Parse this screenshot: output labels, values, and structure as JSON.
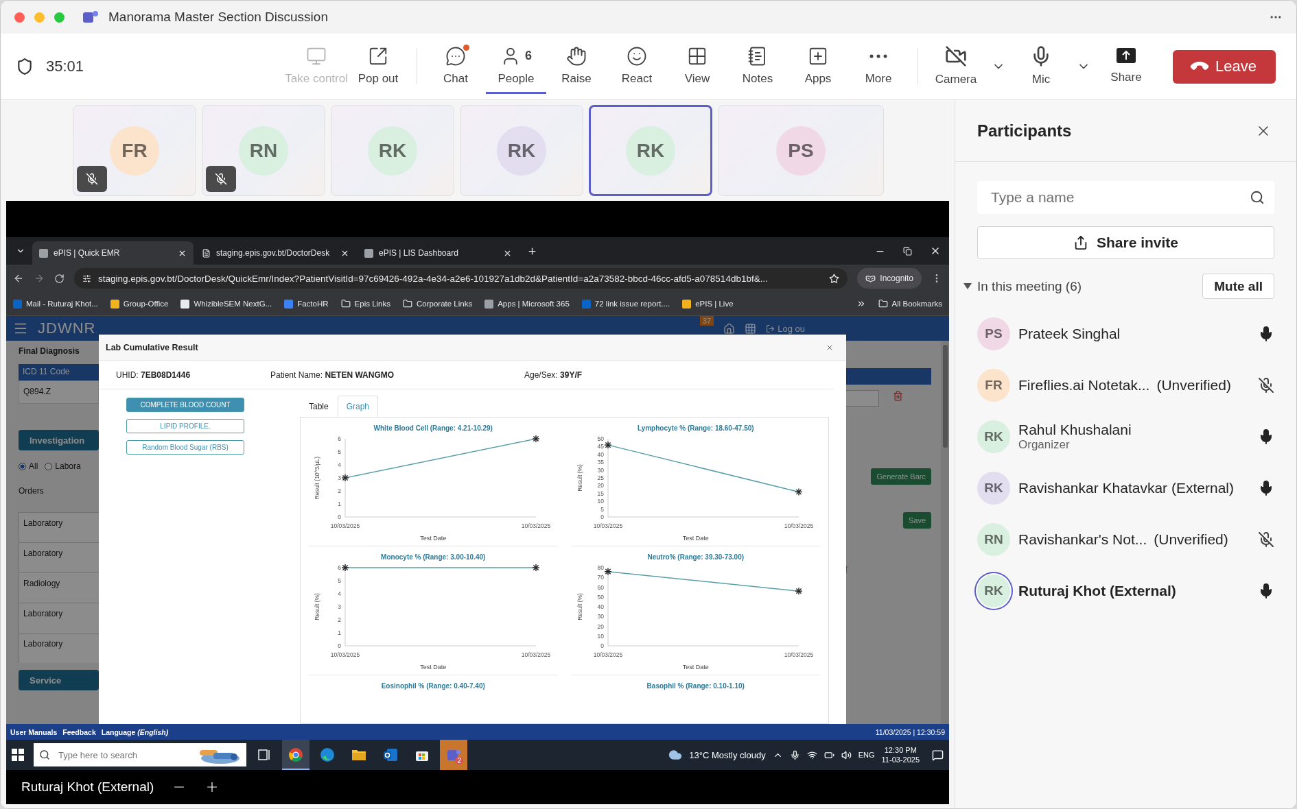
{
  "window": {
    "title": "Manorama Master Section Discussion"
  },
  "toolbar": {
    "timer": "35:01",
    "actions": [
      {
        "label": "Take control",
        "disabled": true,
        "selected": false,
        "notification": false
      },
      {
        "label": "Pop out",
        "disabled": false,
        "selected": false,
        "notification": false
      },
      {
        "label": "Chat",
        "disabled": false,
        "selected": false,
        "notification": true
      },
      {
        "label": "People",
        "disabled": false,
        "selected": true,
        "notification": false,
        "count": "6"
      },
      {
        "label": "Raise",
        "disabled": false,
        "selected": false,
        "notification": false
      },
      {
        "label": "React",
        "disabled": false,
        "selected": false,
        "notification": false
      },
      {
        "label": "View",
        "disabled": false,
        "selected": false,
        "notification": false
      },
      {
        "label": "Notes",
        "disabled": false,
        "selected": false,
        "notification": false
      },
      {
        "label": "Apps",
        "disabled": false,
        "selected": false,
        "notification": false
      },
      {
        "label": "More",
        "disabled": false,
        "selected": false,
        "notification": false
      }
    ],
    "camera": {
      "label": "Camera",
      "on": false
    },
    "mic": {
      "label": "Mic",
      "on": true
    },
    "share": {
      "label": "Share"
    },
    "leave": {
      "label": "Leave"
    }
  },
  "tiles": [
    {
      "initials": "FR",
      "color": "#fbe4cb",
      "muted": true,
      "selected": false
    },
    {
      "initials": "RN",
      "color": "#d9efe0",
      "muted": true,
      "selected": false
    },
    {
      "initials": "RK",
      "color": "#d9efe0",
      "muted": false,
      "selected": false
    },
    {
      "initials": "RK",
      "color": "#e2def0",
      "muted": false,
      "selected": false
    },
    {
      "initials": "RK",
      "color": "#d9efe0",
      "muted": false,
      "selected": true
    },
    {
      "initials": "PS",
      "color": "#f0d8e6",
      "muted": false,
      "selected": false
    }
  ],
  "shared_screen": {
    "browser": {
      "tabs": [
        {
          "title": "ePIS | Quick EMR",
          "selected": true
        },
        {
          "title": "staging.epis.gov.bt/DoctorDesk",
          "selected": false
        },
        {
          "title": "ePIS | LIS Dashboard",
          "selected": false
        }
      ],
      "url": "staging.epis.gov.bt/DoctorDesk/QuickEmr/Index?PatientVisitId=97c69426-492a-4e34-a2e6-101927a1db2d&PatientId=a2a73582-bbcd-46cc-afd5-a078514db1bf&...",
      "mode": "Incognito",
      "bookmarks": [
        {
          "label": "Mail - Ruturaj Khot...",
          "kind": "site"
        },
        {
          "label": "Group-Office",
          "kind": "site"
        },
        {
          "label": "WhizibleSEM NextG...",
          "kind": "site"
        },
        {
          "label": "FactoHR",
          "kind": "site"
        },
        {
          "label": "Epis Links",
          "kind": "folder"
        },
        {
          "label": "Corporate Links",
          "kind": "folder"
        },
        {
          "label": "Apps | Microsoft 365",
          "kind": "site"
        },
        {
          "label": "72 link issue report....",
          "kind": "site"
        },
        {
          "label": "ePIS | Live",
          "kind": "site"
        }
      ],
      "all_bookmarks": "All Bookmarks"
    },
    "emr": {
      "brand": "JDWNR",
      "badge": "37",
      "logout": "Log ou",
      "final_diagnosis": "Final Diagnosis",
      "icd_header": "ICD 11 Code",
      "icd_code": "Q894.Z",
      "investigation": "Investigation",
      "filters": [
        {
          "label": "All",
          "selected": true
        },
        {
          "label": "Labora",
          "selected": false
        }
      ],
      "orders_label": "Orders",
      "order_rows": [
        "Laboratory",
        "Laboratory",
        "Radiology",
        "Laboratory",
        "Laboratory"
      ],
      "generate": "Generate Barc",
      "save": "Save",
      "service": "Service"
    },
    "modal": {
      "title": "Lab Cumulative Result",
      "info": [
        {
          "label": "UHID:",
          "value": "7EB08D1446"
        },
        {
          "label": "Patient Name:",
          "value": "NETEN WANGMO"
        },
        {
          "label": "Age/Sex:",
          "value": "39Y/F"
        }
      ],
      "tests": [
        {
          "label": "COMPLETE BLOOD COUNT",
          "selected": true
        },
        {
          "label": "LIPID PROFILE.",
          "selected": false
        },
        {
          "label": "Random Blood Sugar (RBS)",
          "selected": false
        }
      ],
      "tabs": [
        {
          "label": "Table",
          "selected": false
        },
        {
          "label": "Graph",
          "selected": true
        }
      ],
      "graphs": [
        {
          "title": "White Blood Cell (Range: 4.21-10.29)",
          "chart_data": {
            "type": "line",
            "xlabel": "Test Date",
            "ylabel": "Result (10^3/µL)",
            "categories": [
              "10/03/2025",
              "10/03/2025"
            ],
            "values": [
              3,
              6
            ],
            "marker": "cross",
            "ylim": [
              0,
              6
            ],
            "yticks": [
              0,
              1,
              2,
              3,
              4,
              5,
              6
            ]
          }
        },
        {
          "title": "Lymphocyte % (Range: 18.60-47.50)",
          "chart_data": {
            "type": "line",
            "xlabel": "Test Date",
            "ylabel": "Result (%)",
            "categories": [
              "10/03/2025",
              "10/03/2025"
            ],
            "values": [
              46,
              16
            ],
            "marker": "cross",
            "ylim": [
              0,
              50
            ],
            "yticks": [
              0,
              5,
              10,
              15,
              20,
              25,
              30,
              35,
              40,
              45,
              50
            ]
          }
        },
        {
          "title": "Monocyte % (Range: 3.00-10.40)",
          "chart_data": {
            "type": "line",
            "xlabel": "Test Date",
            "ylabel": "Result (%)",
            "categories": [
              "10/03/2025",
              "10/03/2025"
            ],
            "values": [
              6,
              6
            ],
            "marker": "cross",
            "ylim": [
              0,
              6
            ],
            "yticks": [
              0,
              1,
              2,
              3,
              4,
              5,
              6
            ]
          }
        },
        {
          "title": "Neutro% (Range: 39.30-73.00)",
          "chart_data": {
            "type": "line",
            "xlabel": "Test Date",
            "ylabel": "Result (%)",
            "categories": [
              "10/03/2025",
              "10/03/2025"
            ],
            "values": [
              76,
              56
            ],
            "marker": "cross",
            "ylim": [
              0,
              80
            ],
            "yticks": [
              0,
              10,
              20,
              30,
              40,
              50,
              60,
              70,
              80
            ]
          }
        },
        {
          "title": "Eosinophil % (Range: 0.40-7.40)"
        },
        {
          "title": "Basophil % (Range: 0.10-1.10)"
        }
      ]
    },
    "footer": {
      "links": [
        "User Manuals",
        "Feedback",
        "Language *(English)*"
      ],
      "datetime": "11/03/2025 | 12:30:59"
    },
    "taskbar": {
      "search_placeholder": "Type here to search",
      "apps": [
        {
          "active": true,
          "attention": false
        },
        {
          "active": false,
          "attention": false
        },
        {
          "active": false,
          "attention": false
        },
        {
          "active": false,
          "attention": false
        },
        {
          "active": false,
          "attention": false
        },
        {
          "active": false,
          "attention": true,
          "badge": "2"
        }
      ],
      "weather": "13°C  Mostly cloudy",
      "language": "ENG",
      "time": "12:30 PM",
      "date": "11-03-2025"
    },
    "presenter": "Ruturaj Khot (External)"
  },
  "panel": {
    "title": "Participants",
    "search_placeholder": "Type a name",
    "invite": "Share invite",
    "section": {
      "label": "In this meeting (6)",
      "expanded": true,
      "mute_all": "Mute all"
    },
    "people": [
      {
        "initials": "PS",
        "color": "#f0d8e6",
        "name": "Prateek Singhal",
        "muted": false,
        "speaking": false
      },
      {
        "initials": "FR",
        "color": "#fbe4cb",
        "name": "Fireflies.ai Notetak...",
        "tag": "(Unverified)",
        "muted": true,
        "speaking": false
      },
      {
        "initials": "RK",
        "color": "#d9efe0",
        "name": "Rahul Khushalani",
        "role": "Organizer",
        "muted": false,
        "speaking": false
      },
      {
        "initials": "RK",
        "color": "#e2def0",
        "name": "Ravishankar Khatavkar (External)",
        "muted": false,
        "speaking": false
      },
      {
        "initials": "RN",
        "color": "#d9efe0",
        "name": "Ravishankar's Not...",
        "tag": "(Unverified)",
        "muted": true,
        "speaking": false
      },
      {
        "initials": "RK",
        "color": "#d9efe0",
        "name": "Ruturaj Khot (External)",
        "muted": false,
        "speaking": true
      }
    ]
  }
}
